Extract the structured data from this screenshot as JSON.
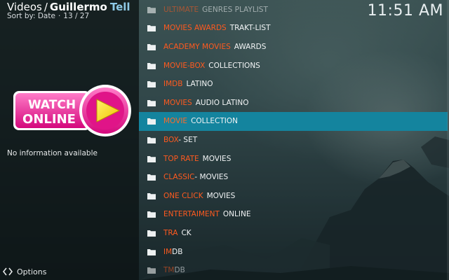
{
  "header": {
    "section": "Videos",
    "separator": "/",
    "title_first": "Guillermo",
    "title_second": "Tell",
    "sort_label": "Sort by: Date",
    "sub_separator": "·",
    "position": "13 / 27"
  },
  "clock": "11:51 AM",
  "thumbnail": {
    "line1": "WATCH",
    "line2": "ONLINE",
    "colors": {
      "pink": "#e8148c",
      "pink_light": "#ff6fc0",
      "yellow": "#f7e600"
    }
  },
  "info_text": "No information available",
  "options_label": "Options",
  "menu": {
    "items": [
      {
        "a": "ULTIMATE",
        "b": "GENRES PLAYLIST",
        "state": "dim"
      },
      {
        "a": "MOVIES AWARDS",
        "b": "TRAKT-LIST"
      },
      {
        "a": "ACADEMY MOVIES",
        "b": "AWARDS"
      },
      {
        "a": "MOVIE-BOX",
        "b": "COLLECTIONS"
      },
      {
        "a": "IMDB",
        "b": "LATINO"
      },
      {
        "a": "MOVIES",
        "b": "AUDIO LATINO"
      },
      {
        "a": "MOVIE",
        "b": "COLLECTION",
        "state": "selected"
      },
      {
        "a": "BOX",
        "b": "- SET"
      },
      {
        "a": "TOP RATE",
        "b": "MOVIES"
      },
      {
        "a": "CLASSIC",
        "b": "- MOVIES"
      },
      {
        "a": "ONE CLICK",
        "b": "MOVIES"
      },
      {
        "a": "ENTERTAIMENT",
        "b": "ONLINE"
      },
      {
        "a": "TRA",
        "b": "CK"
      },
      {
        "a": "IM",
        "b": "DB"
      },
      {
        "a": "TM",
        "b": "DB",
        "state": "dim"
      }
    ]
  },
  "colors": {
    "accent_orange": "#ff5a1f",
    "selection": "#14849e",
    "title_blue": "#8ec9e6"
  }
}
